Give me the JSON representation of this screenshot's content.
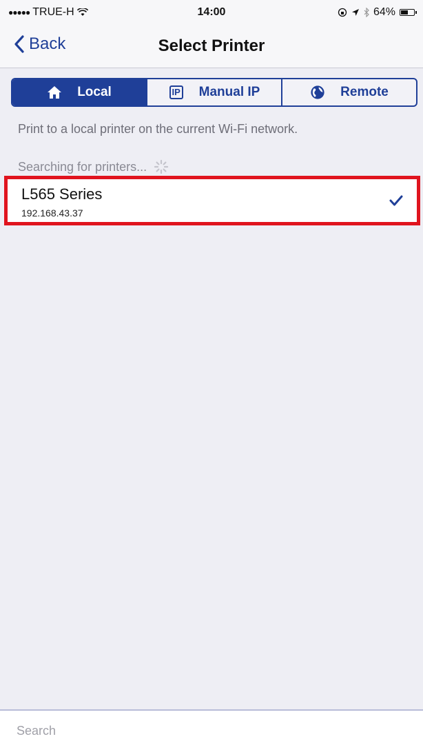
{
  "status_bar": {
    "carrier": "TRUE-H",
    "time": "14:00",
    "battery": "64%",
    "battery_level": 0.64
  },
  "nav": {
    "back_label": "Back",
    "title": "Select Printer"
  },
  "segments": [
    {
      "label": "Local",
      "icon": "home-icon",
      "active": true
    },
    {
      "label": "Manual IP",
      "icon": "ip-icon",
      "icon_text": "IP",
      "active": false
    },
    {
      "label": "Remote",
      "icon": "globe-icon",
      "active": false
    }
  ],
  "hint": "Print to a local printer on the current Wi-Fi network.",
  "searching": "Searching for printers...",
  "printers": [
    {
      "name": "L565 Series",
      "ip": "192.168.43.37",
      "selected": true
    }
  ],
  "search": {
    "placeholder": "Search",
    "value": ""
  },
  "colors": {
    "accent": "#1f3f98",
    "highlight": "#e0141e",
    "background": "#eeeef4"
  }
}
